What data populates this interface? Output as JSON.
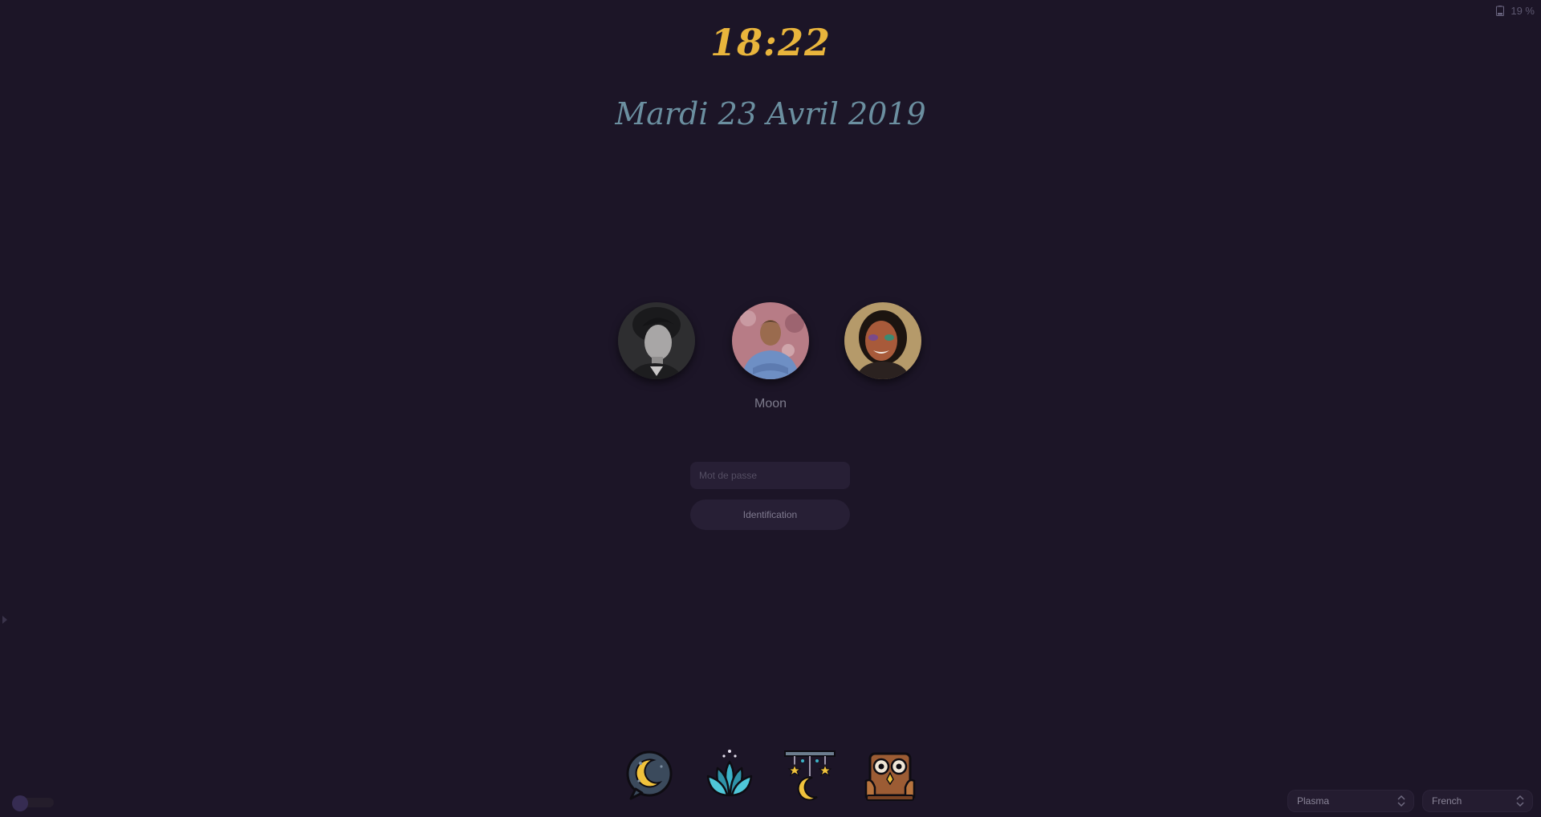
{
  "status": {
    "battery_text": "19 %"
  },
  "clock": {
    "time": "18:22",
    "date": "Mardi 23 Avril 2019"
  },
  "users": {
    "selected_name": "Moon",
    "avatars": [
      "user-avatar-1",
      "user-avatar-2",
      "user-avatar-3"
    ]
  },
  "login": {
    "password_placeholder": "Mot de passe",
    "password_value": "",
    "button_label": "Identification"
  },
  "bottom_icons": [
    "moon-bubble-icon",
    "lotus-icon",
    "hanging-moon-icon",
    "owl-icon"
  ],
  "session": {
    "selected": "Plasma"
  },
  "language": {
    "selected": "French"
  },
  "colors": {
    "background": "#1c1527",
    "clock": "#e9b53c",
    "date": "#6b8fa0",
    "field": "#271f35"
  }
}
